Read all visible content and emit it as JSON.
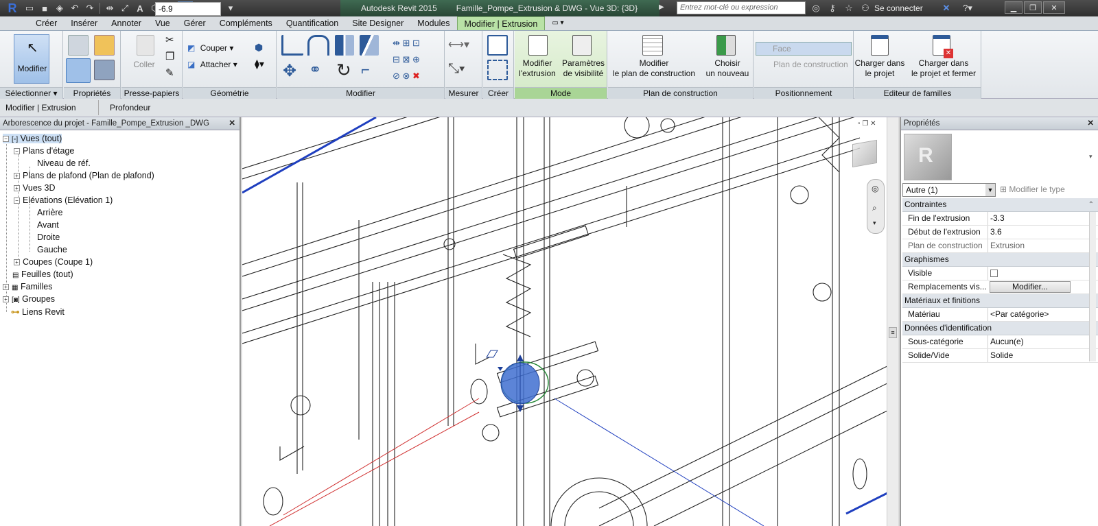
{
  "titlebar": {
    "app_title": "Autodesk Revit 2015",
    "doc_title": "Famille_Pompe_Extrusion & DWG - Vue 3D: {3D}",
    "search_placeholder": "Entrez mot-clé ou expression",
    "signin": "Se connecter",
    "logo": "R"
  },
  "tabs": [
    "Créer",
    "Insérer",
    "Annoter",
    "Vue",
    "Gérer",
    "Compléments",
    "Quantification",
    "Site Designer",
    "Modules",
    "Modifier | Extrusion"
  ],
  "ribbon": {
    "select": {
      "button": "Modifier",
      "title": "Sélectionner"
    },
    "properties": {
      "title": "Propriétés"
    },
    "clipboard": {
      "paste": "Coller",
      "title": "Presse-papiers"
    },
    "geometry": {
      "cut": "Couper",
      "join": "Attacher",
      "title": "Géométrie"
    },
    "modify": {
      "title": "Modifier"
    },
    "measure": {
      "title": "Mesurer"
    },
    "create": {
      "title": "Créer"
    },
    "mode": {
      "edit_l1": "Modifier",
      "edit_l2": "l'extrusion",
      "vis_l1": "Paramètres",
      "vis_l2": "de visibilité",
      "title": "Mode"
    },
    "workplane": {
      "set_l1": "Modifier",
      "set_l2": "le plan de construction",
      "pick_l1": "Choisir",
      "pick_l2": "un nouveau",
      "title": "Plan de construction"
    },
    "placement": {
      "face": "Face",
      "workplane": "Plan de construction",
      "title": "Positionnement"
    },
    "family_editor": {
      "load_l1": "Charger dans",
      "load_l2": "le projet",
      "loadclose_l1": "Charger dans",
      "loadclose_l2": "le projet et fermer",
      "title": "Editeur de familles"
    }
  },
  "optionsbar": {
    "context": "Modifier | Extrusion",
    "depth_label": "Profondeur",
    "depth_value": "-6.9"
  },
  "browser": {
    "title": "Arborescence du projet - Famille_Pompe_Extrusion _DWG",
    "nodes": {
      "views": "Vues (tout)",
      "floorplans": "Plans d'étage",
      "level": "Niveau de réf.",
      "ceiling": "Plans de plafond (Plan de plafond)",
      "views3d": "Vues 3D",
      "elevations": "Elévations (Elévation 1)",
      "back": "Arrière",
      "front": "Avant",
      "right": "Droite",
      "left": "Gauche",
      "sections": "Coupes (Coupe 1)",
      "sheets": "Feuilles (tout)",
      "families": "Familles",
      "groups": "Groupes",
      "links": "Liens Revit"
    }
  },
  "properties": {
    "title": "Propriétés",
    "type_selector": "Autre (1)",
    "edit_type": "Modifier le type",
    "groups": {
      "constraints": "Contraintes",
      "graphics": "Graphismes",
      "materials": "Matériaux et finitions",
      "identity": "Données d'identification"
    },
    "rows": {
      "ext_end": {
        "k": "Fin de l'extrusion",
        "v": "-3.3"
      },
      "ext_start": {
        "k": "Début de l'extrusion",
        "v": "3.6"
      },
      "workplane": {
        "k": "Plan de construction",
        "v": "Extrusion"
      },
      "visible": {
        "k": "Visible"
      },
      "vis_override": {
        "k": "Remplacements vis...",
        "v": "Modifier..."
      },
      "material": {
        "k": "Matériau",
        "v": "<Par catégorie>"
      },
      "subcategory": {
        "k": "Sous-catégorie",
        "v": "Aucun(e)"
      },
      "solid_void": {
        "k": "Solide/Vide",
        "v": "Solide"
      }
    }
  },
  "colors": {
    "ribbon_green": "#b9e2a6",
    "selection_blue": "#3f6fd0",
    "axis_red": "#d03030",
    "axis_blue": "#1f3fbf"
  }
}
